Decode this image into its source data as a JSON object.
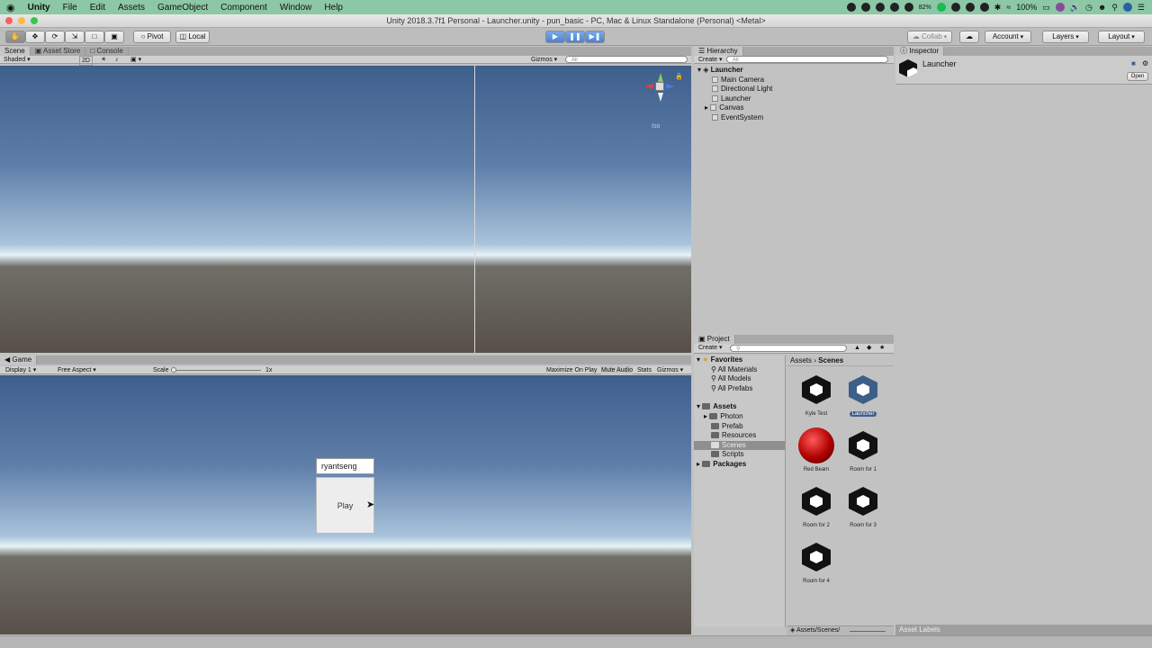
{
  "menubar": {
    "items": [
      "Unity",
      "File",
      "Edit",
      "Assets",
      "GameObject",
      "Component",
      "Window",
      "Help"
    ],
    "battery": "100%",
    "percent": "82%"
  },
  "window": {
    "title": "Unity 2018.3.7f1 Personal - Launcher.unity - pun_basic - PC, Mac & Linux Standalone (Personal) <Metal>"
  },
  "toolbar": {
    "pivot": "Pivot",
    "local": "Local",
    "collab": "Collab",
    "account": "Account",
    "layers": "Layers",
    "layout": "Layout"
  },
  "scene": {
    "tabs": [
      "Scene",
      "Asset Store",
      "Console"
    ],
    "shading": "Shaded",
    "mode_2d": "2D",
    "gizmos": "Gizmos",
    "search_placeholder": "All",
    "persp_label": "Iso"
  },
  "game": {
    "tab": "Game",
    "display": "Display 1",
    "aspect": "Free Aspect",
    "scale_label": "Scale",
    "scale_value": "1x",
    "maximize": "Maximize On Play",
    "mute": "Mute Audio",
    "stats": "Stats",
    "gizmos": "Gizmos",
    "name_input": "ryantseng",
    "play_button": "Play"
  },
  "hierarchy": {
    "tab": "Hierarchy",
    "create": "Create",
    "search_placeholder": "All",
    "scene": "Launcher",
    "items": [
      "Main Camera",
      "Directional Light",
      "Launcher",
      "Canvas",
      "EventSystem"
    ]
  },
  "project": {
    "tab": "Project",
    "create": "Create",
    "favorites": "Favorites",
    "fav_items": [
      "All Materials",
      "All Models",
      "All Prefabs"
    ],
    "assets": "Assets",
    "asset_folders": [
      "Photon",
      "Prefab",
      "Resources",
      "Scenes",
      "Scripts"
    ],
    "packages": "Packages",
    "breadcrumb": [
      "Assets",
      "Scenes"
    ],
    "path": "Assets/Scenes/",
    "asset_labels": "Asset Labels",
    "files": [
      {
        "name": "Kyle Test",
        "kind": "scene"
      },
      {
        "name": "Launcher",
        "kind": "scene",
        "selected": true
      },
      {
        "name": "Red Beam",
        "kind": "material"
      },
      {
        "name": "Room for 1",
        "kind": "scene"
      },
      {
        "name": "Room for 2",
        "kind": "scene"
      },
      {
        "name": "Room for 3",
        "kind": "scene"
      },
      {
        "name": "Room for 4",
        "kind": "scene"
      }
    ]
  },
  "inspector": {
    "tab": "Inspector",
    "object": "Launcher",
    "open": "Open"
  },
  "colors": {
    "menubar": "#8cc8a5",
    "play_active": "#4c82d2",
    "selection": "#3d5f8a"
  }
}
